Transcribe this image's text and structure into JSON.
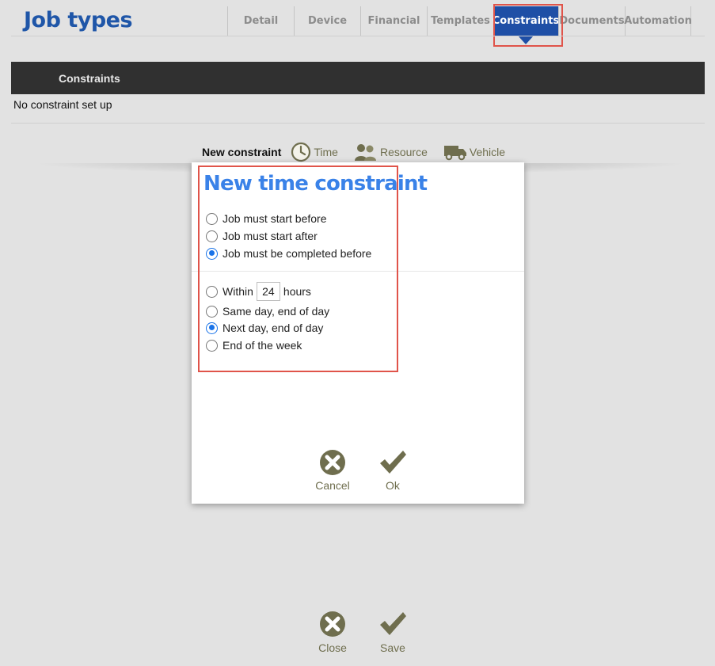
{
  "header": {
    "title": "Job types",
    "tabs": [
      {
        "label": "Detail"
      },
      {
        "label": "Device"
      },
      {
        "label": "Financial"
      },
      {
        "label": "Templates"
      },
      {
        "label": "Constraints",
        "active": true
      },
      {
        "label": "Documents"
      },
      {
        "label": "Automation"
      }
    ]
  },
  "constraints_section": {
    "heading": "Constraints",
    "empty_message": "No constraint set up"
  },
  "new_constraint": {
    "label": "New constraint",
    "options": [
      {
        "label": "Time",
        "icon": "clock-icon"
      },
      {
        "label": "Resource",
        "icon": "people-icon"
      },
      {
        "label": "Vehicle",
        "icon": "van-icon"
      }
    ]
  },
  "footer": {
    "close_label": "Close",
    "save_label": "Save"
  },
  "modal": {
    "title": "New time constraint",
    "mode_options": [
      {
        "label": "Job must start before",
        "checked": false
      },
      {
        "label": "Job must start after",
        "checked": false
      },
      {
        "label": "Job must be completed before",
        "checked": true
      }
    ],
    "within_label": "Within",
    "within_hours_value": "24",
    "hours_label": "hours",
    "deadline_options": [
      {
        "label": "Same day, end of day",
        "checked": false
      },
      {
        "label": "Next day, end of day",
        "checked": true
      },
      {
        "label": "End of the week",
        "checked": false
      }
    ],
    "cancel_label": "Cancel",
    "ok_label": "Ok"
  },
  "colors": {
    "accent": "#1f4fa6",
    "title_blue": "#1f56a8",
    "modal_title_blue": "#3a82e8",
    "highlight_red": "#e0544a",
    "olive": "#6f6e4e"
  }
}
